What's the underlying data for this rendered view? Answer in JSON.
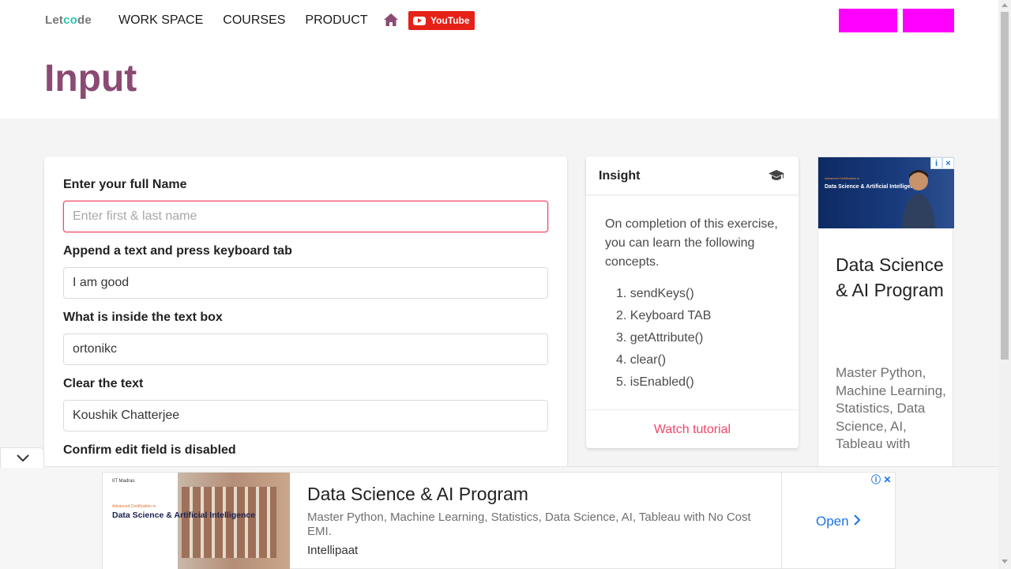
{
  "header": {
    "logo": {
      "part1": "Let",
      "part2": "co",
      "part3": "de"
    },
    "nav": [
      "WORK SPACE",
      "COURSES",
      "PRODUCT"
    ],
    "youtube_label": "YouTube",
    "page_title": "Input"
  },
  "form": {
    "fields": [
      {
        "label": "Enter your full Name",
        "value": "",
        "placeholder": "Enter first & last name"
      },
      {
        "label": "Append a text and press keyboard tab",
        "value": "I am good",
        "placeholder": ""
      },
      {
        "label": "What is inside the text box",
        "value": "ortonikc",
        "placeholder": ""
      },
      {
        "label": "Clear the text",
        "value": "Koushik Chatterjee",
        "placeholder": ""
      },
      {
        "label": "Confirm edit field is disabled"
      }
    ]
  },
  "insight": {
    "title": "Insight",
    "intro": "On completion of this exercise, you can learn the following concepts.",
    "concepts": [
      "1. sendKeys()",
      "2. Keyboard TAB",
      "3. getAttribute()",
      "4. clear()",
      "5. isEnabled()"
    ],
    "watch_label": "Watch tutorial"
  },
  "side_ad": {
    "img_cert": "Advanced Certification in",
    "img_heading": "Data Science & Artificial Intelligence",
    "title": "Data Science & AI Program",
    "description": "Master Python, Machine Learning, Statistics, Data Science, AI, Tableau with"
  },
  "bottom_ad": {
    "img_logo": "IIT Madras",
    "img_cert": "Advanced Certification in",
    "img_heading": "Data Science & Artificial Intelligence",
    "title": "Data Science & AI Program",
    "description": "Master Python, Machine Learning, Statistics, Data Science, AI, Tableau with No Cost EMI.",
    "brand": "Intellipaat",
    "open_label": "Open"
  },
  "colors": {
    "title": "#8b4a73",
    "youtube": "#e62117",
    "magenta_buttons": "#ff00ff",
    "link": "#f14668",
    "ad_link": "#1a73e8"
  }
}
